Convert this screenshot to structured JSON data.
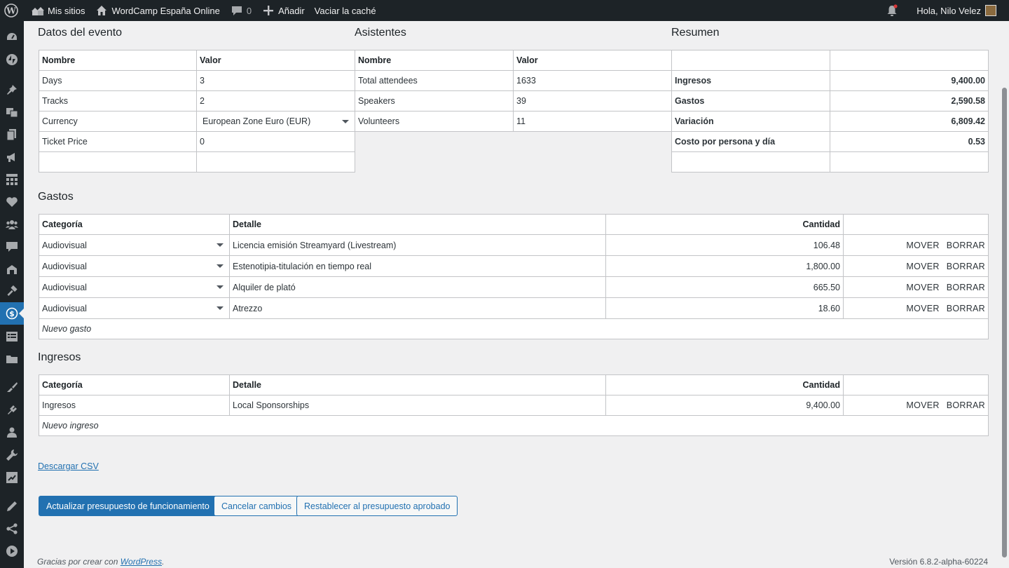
{
  "adminbar": {
    "my_sites": "Mis sitios",
    "site_name": "WordCamp España Online",
    "comments_count": "0",
    "add_new": "Añadir",
    "clear_cache": "Vaciar la caché",
    "greeting": "Hola, Nilo Velez"
  },
  "event": {
    "title": "Datos del evento",
    "col_name": "Nombre",
    "col_value": "Valor",
    "rows": [
      {
        "name": "Days",
        "value": "3"
      },
      {
        "name": "Tracks",
        "value": "2"
      },
      {
        "name": "Currency",
        "value": "European Zone Euro (EUR)"
      },
      {
        "name": "Ticket Price",
        "value": "0"
      }
    ]
  },
  "attendees": {
    "title": "Asistentes",
    "col_name": "Nombre",
    "col_value": "Valor",
    "rows": [
      {
        "name": "Total attendees",
        "value": "1633"
      },
      {
        "name": "Speakers",
        "value": "39"
      },
      {
        "name": "Volunteers",
        "value": "11"
      }
    ]
  },
  "summary": {
    "title": "Resumen",
    "rows": [
      {
        "name": "Ingresos",
        "value": "9,400.00"
      },
      {
        "name": "Gastos",
        "value": "2,590.58"
      },
      {
        "name": "Variación",
        "value": "6,809.42"
      },
      {
        "name": "Costo por persona y día",
        "value": "0.53"
      }
    ]
  },
  "expenses": {
    "title": "Gastos",
    "col_category": "Categoría",
    "col_detail": "Detalle",
    "col_amount": "Cantidad",
    "move_label": "MOVER",
    "delete_label": "BORRAR",
    "new_placeholder": "Nuevo gasto",
    "rows": [
      {
        "category": "Audiovisual",
        "detail": "Licencia emisión Streamyard (Livestream)",
        "amount": "106.48"
      },
      {
        "category": "Audiovisual",
        "detail": "Estenotipia-titulación en tiempo real",
        "amount": "1,800.00"
      },
      {
        "category": "Audiovisual",
        "detail": "Alquiler de plató",
        "amount": "665.50"
      },
      {
        "category": "Audiovisual",
        "detail": "Atrezzo",
        "amount": "18.60"
      }
    ]
  },
  "income": {
    "title": "Ingresos",
    "col_category": "Categoría",
    "col_detail": "Detalle",
    "col_amount": "Cantidad",
    "move_label": "MOVER",
    "delete_label": "BORRAR",
    "new_placeholder": "Nuevo ingreso",
    "rows": [
      {
        "category": "Ingresos",
        "detail": "Local Sponsorships",
        "amount": "9,400.00"
      }
    ]
  },
  "actions": {
    "download_csv": "Descargar CSV",
    "update": "Actualizar presupuesto de funcionamiento",
    "cancel": "Cancelar cambios",
    "reset": "Restablecer al presupuesto aprobado"
  },
  "footer": {
    "thanks_prefix": "Gracias por crear con ",
    "thanks_link": "WordPress",
    "thanks_suffix": ".",
    "version": "Versión 6.8.2-alpha-60224"
  },
  "colors": {
    "admin_bar": "#1d2327",
    "accent": "#2271b1",
    "background": "#f0f0f1"
  }
}
